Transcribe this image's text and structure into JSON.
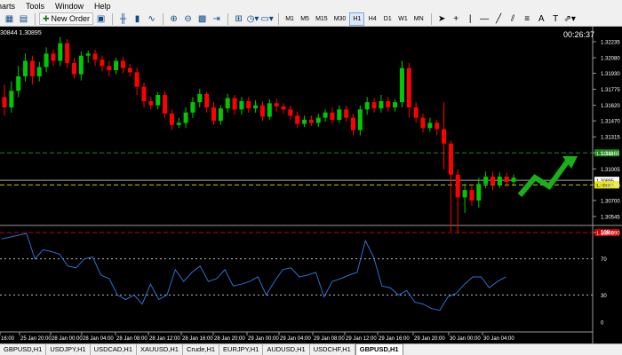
{
  "menu": {
    "items": [
      "harts",
      "Tools",
      "Window",
      "Help"
    ]
  },
  "toolbar": {
    "new_order_label": "New Order",
    "timeframes": [
      "M1",
      "M5",
      "M15",
      "M30",
      "H1",
      "H4",
      "D1",
      "W1",
      "MN"
    ],
    "active_timeframe": "H1"
  },
  "chart": {
    "info_text": "30844 1.30895",
    "clock": "00:26:37",
    "price_labels": [
      "1.32235",
      "1.32080",
      "1.31930",
      "1.31775",
      "1.31620",
      "1.31470",
      "1.31315",
      "1.31160",
      "1.31005",
      "1.30850",
      "1.30700",
      "1.30545",
      "1.30390"
    ],
    "level_green": "1.31160",
    "level_bid": "1.30895",
    "level_yellow": "1.30850",
    "level_red": "1.30390",
    "time_labels": [
      "16:00",
      "25 Jan 20:00",
      "28 Jan 00:00",
      "28 Jan 04:00",
      "28 Jan 08:00",
      "28 Jan 12:00",
      "28 Jan 16:00",
      "28 Jan 20:00",
      "29 Jan 00:00",
      "29 Jan 04:00",
      "29 Jan 08:00",
      "29 Jan 12:00",
      "29 Jan 16:00",
      "29 Jan 20:00",
      "30 Jan 00:00",
      "30 Jan 04:00"
    ],
    "indicator_labels": [
      "100",
      "70",
      "30",
      "0"
    ],
    "colors": {
      "bull": "#00c800",
      "bear": "#ff0000",
      "indicator": "#2f6fd0",
      "green_line": "#1a8a1a",
      "yellow_line": "#c8c800",
      "red_line": "#c80000"
    }
  },
  "tabs": [
    "GBPUSD,H1",
    "USDJPY,H1",
    "USDCAD,H1",
    "XAUUSD,H1",
    "Crude,H1",
    "EURJPY,H1",
    "AUDUSD,H1",
    "USDCHF,H1",
    "GBPUSD,H1"
  ],
  "active_tab": 8
}
